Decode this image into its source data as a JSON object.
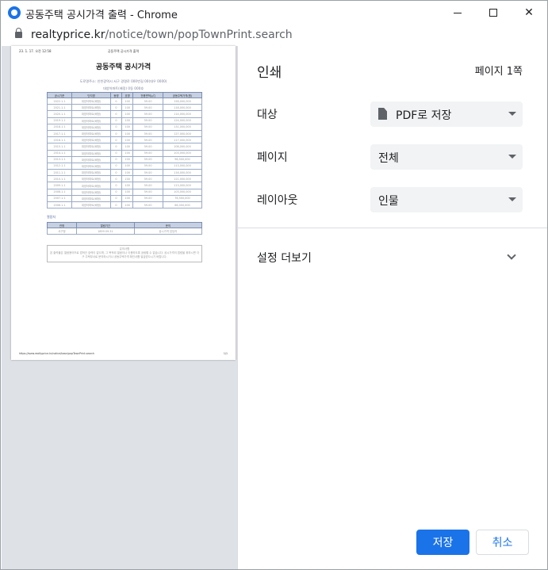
{
  "window": {
    "title": "공동주택 공시가격 출력 - Chrome"
  },
  "address": {
    "host": "realtyprice.kr",
    "path": "/notice/town/popTownPrint.search"
  },
  "preview": {
    "header_date": "23. 1. 17. 오전 12:58",
    "header_title": "공동주택 공시가격 출력",
    "title": "공동주택 공시가격",
    "address_line1": "도로명주소: 인천광역시 서구 경명로 000번길 00(대우 0000)",
    "address_line2": "대양아파트(배정) 0동 000호",
    "table": {
      "headers": [
        "공시기준",
        "단지명",
        "동명",
        "호명",
        "전용면적(㎡)",
        "공동주택가격(원)"
      ],
      "rows": [
        [
          "2022.1.1",
          "대양아파트(배정)",
          "0",
          "100",
          "59.00",
          "158,000,000"
        ],
        [
          "2021.1.1",
          "대양아파트(배정)",
          "0",
          "100",
          "59.00",
          "118,000,000"
        ],
        [
          "2020.1.1",
          "대양아파트(배정)",
          "0",
          "100",
          "59.00",
          "114,000,000"
        ],
        [
          "2019.1.1",
          "대양아파트(배정)",
          "0",
          "100",
          "59.00",
          "124,000,000"
        ],
        [
          "2018.1.1",
          "대양아파트(배정)",
          "0",
          "100",
          "59.00",
          "131,000,000"
        ],
        [
          "2017.1.1",
          "대양아파트(배정)",
          "0",
          "100",
          "59.00",
          "127,000,000"
        ],
        [
          "2016.1.1",
          "대양아파트(배정)",
          "0",
          "100",
          "59.00",
          "117,000,000"
        ],
        [
          "2015.1.1",
          "대양아파트(배정)",
          "0",
          "100",
          "59.00",
          "108,000,000"
        ],
        [
          "2014.1.1",
          "대양아파트(배정)",
          "0",
          "100",
          "59.00",
          "103,000,000"
        ],
        [
          "2013.1.1",
          "대양아파트(배정)",
          "0",
          "100",
          "59.00",
          "96,500,000"
        ],
        [
          "2012.1.1",
          "대양아파트(배정)",
          "0",
          "100",
          "59.00",
          "113,000,000"
        ],
        [
          "2011.1.1",
          "대양아파트(배정)",
          "0",
          "100",
          "59.00",
          "116,000,000"
        ],
        [
          "2010.1.1",
          "대양아파트(배정)",
          "0",
          "100",
          "59.00",
          "121,000,000"
        ],
        [
          "2009.1.1",
          "대양아파트(배정)",
          "0",
          "100",
          "59.00",
          "113,000,000"
        ],
        [
          "2008.1.1",
          "대양아파트(배정)",
          "0",
          "100",
          "59.00",
          "103,000,000"
        ],
        [
          "2007.1.1",
          "대양아파트(배정)",
          "0",
          "100",
          "59.00",
          "76,500,000"
        ],
        [
          "2006.1.1",
          "대양아파트(배정)",
          "0",
          "100",
          "59.00",
          "66,000,000"
        ]
      ]
    },
    "section2_title": "열람처",
    "table2": {
      "headers": [
        "관청",
        "열람기간",
        "문의"
      ],
      "rows": [
        [
          "서구청",
          "1899.09.31",
          "공시가격 담당자"
        ]
      ]
    },
    "notice_title": "유의사항",
    "notice_text": "본 출력물은 열람용이므로 법적인 효력이 없으며, 그 목적외 열람이나 이용하도록 공람할 수 없습니다. 공시가격의 법령을 위하시면 각 구 주택부서로 문의하시거나 공동주택가격 확인서를 발급받으시기 바랍니다.",
    "footer_url": "https://www.realtyprice.kr/notice/town/popTownPrint.search",
    "footer_page": "1/1"
  },
  "settings": {
    "title": "인쇄",
    "page_count": "페이지 1쪽",
    "destination_label": "대상",
    "destination_value": "PDF로 저장",
    "pages_label": "페이지",
    "pages_value": "전체",
    "layout_label": "레이아웃",
    "layout_value": "인물",
    "more_settings_label": "설정 더보기",
    "save_label": "저장",
    "cancel_label": "취소"
  },
  "colors": {
    "accent": "#1a73e8",
    "preview_bg": "#dee1e6",
    "select_bg": "#f1f3f4"
  }
}
